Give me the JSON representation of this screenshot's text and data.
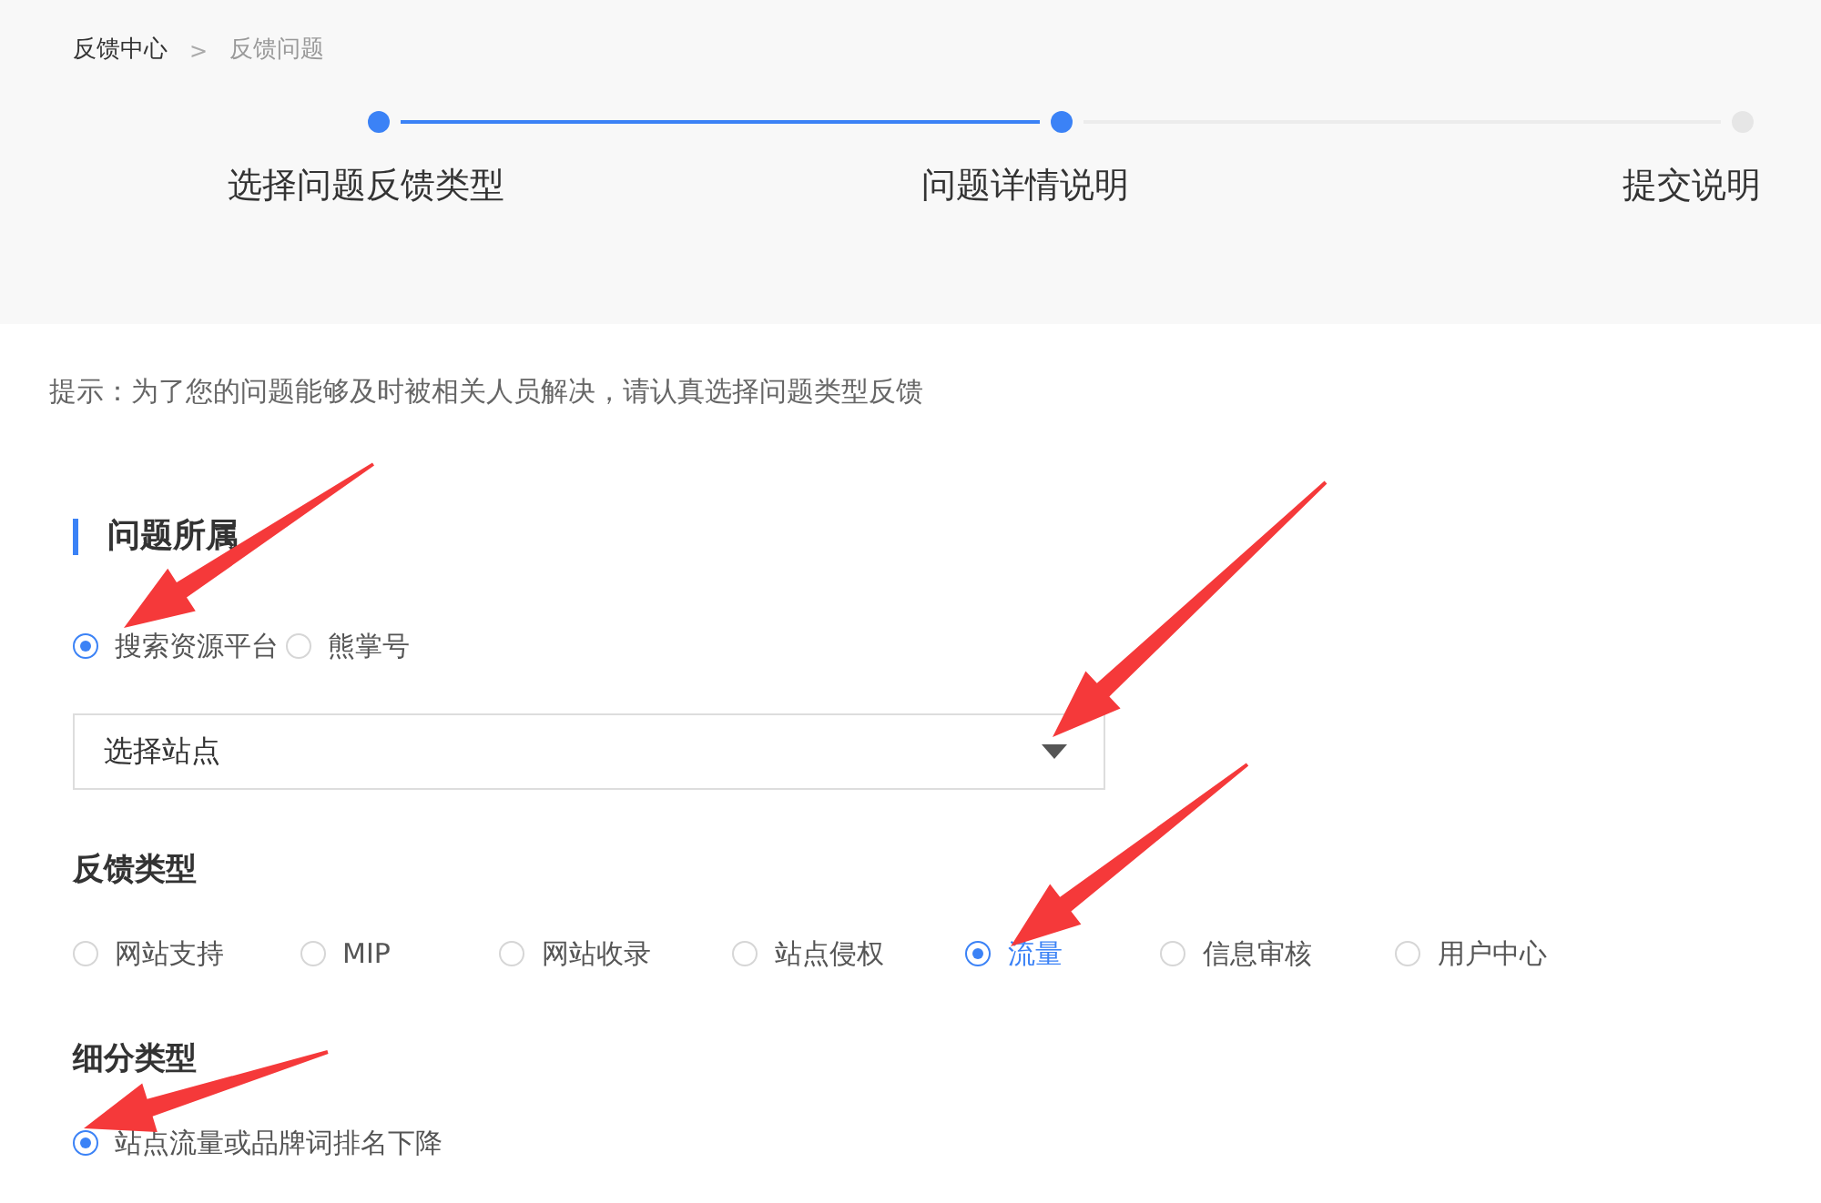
{
  "breadcrumb": [
    {
      "label": "反馈中心",
      "current": false
    },
    {
      "label": "反馈问题",
      "current": true
    }
  ],
  "breadcrumb_separator": ">",
  "steps": [
    {
      "label": "选择问题反馈类型",
      "reached": true
    },
    {
      "label": "问题详情说明",
      "reached": true
    },
    {
      "label": "提交说明",
      "reached": false
    }
  ],
  "hint": "提示：为了您的问题能够及时被相关人员解决，请认真选择问题类型反馈",
  "section_title": "问题所属",
  "platform_options": [
    {
      "label": "搜索资源平台",
      "selected": true
    },
    {
      "label": "熊掌号",
      "selected": false
    }
  ],
  "site_select": {
    "placeholder": "选择站点"
  },
  "feedback_type": {
    "title": "反馈类型",
    "options": [
      {
        "label": "网站支持",
        "selected": false
      },
      {
        "label": "MIP",
        "selected": false
      },
      {
        "label": "网站收录",
        "selected": false
      },
      {
        "label": "站点侵权",
        "selected": false
      },
      {
        "label": "流量",
        "selected": true
      },
      {
        "label": "信息审核",
        "selected": false
      },
      {
        "label": "用户中心",
        "selected": false
      }
    ]
  },
  "subtype": {
    "title": "细分类型",
    "options": [
      {
        "label": "站点流量或品牌词排名下降",
        "selected": true
      }
    ]
  }
}
